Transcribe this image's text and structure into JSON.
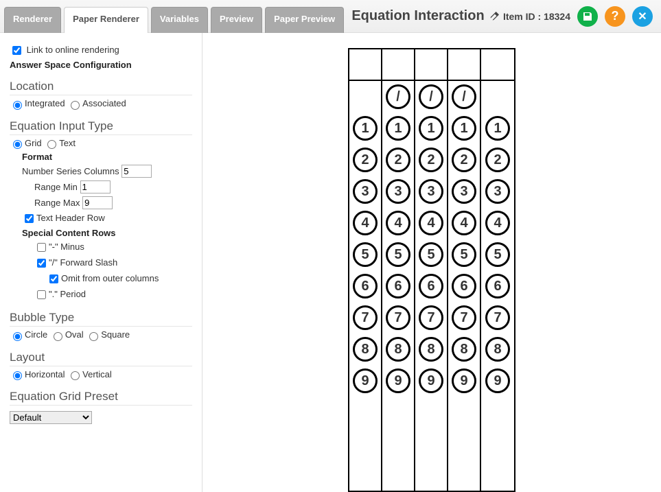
{
  "tabs": [
    "Renderer",
    "Paper Renderer",
    "Variables",
    "Preview",
    "Paper Preview"
  ],
  "active_tab_index": 1,
  "title": "Equation Interaction",
  "item_id_label": "Item ID : 18324",
  "sidebar": {
    "link_online": "Link to online rendering",
    "answer_space_cfg": "Answer Space Configuration",
    "location_h": "Location",
    "loc_integrated": "Integrated",
    "loc_associated": "Associated",
    "eq_input_h": "Equation Input Type",
    "eq_grid": "Grid",
    "eq_text": "Text",
    "format_h": "Format",
    "num_series_cols_lbl": "Number Series Columns",
    "num_series_cols_val": "5",
    "range_min_lbl": "Range Min",
    "range_min_val": "1",
    "range_max_lbl": "Range Max",
    "range_max_val": "9",
    "text_header_row": "Text Header Row",
    "special_rows_h": "Special Content Rows",
    "minus_lbl": "\"-\" Minus",
    "fslash_lbl": "\"/\" Forward Slash",
    "omit_outer_lbl": "Omit from outer columns",
    "period_lbl": "\".\" Period",
    "bubble_type_h": "Bubble Type",
    "bt_circle": "Circle",
    "bt_oval": "Oval",
    "bt_square": "Square",
    "layout_h": "Layout",
    "ly_horizontal": "Horizontal",
    "ly_vertical": "Vertical",
    "preset_h": "Equation Grid Preset",
    "preset_val": "Default"
  },
  "grid": {
    "columns": 5,
    "slash_char": "/",
    "slash_in_col": [
      false,
      true,
      true,
      true,
      false
    ],
    "digits": [
      "1",
      "2",
      "3",
      "4",
      "5",
      "6",
      "7",
      "8",
      "9"
    ]
  }
}
